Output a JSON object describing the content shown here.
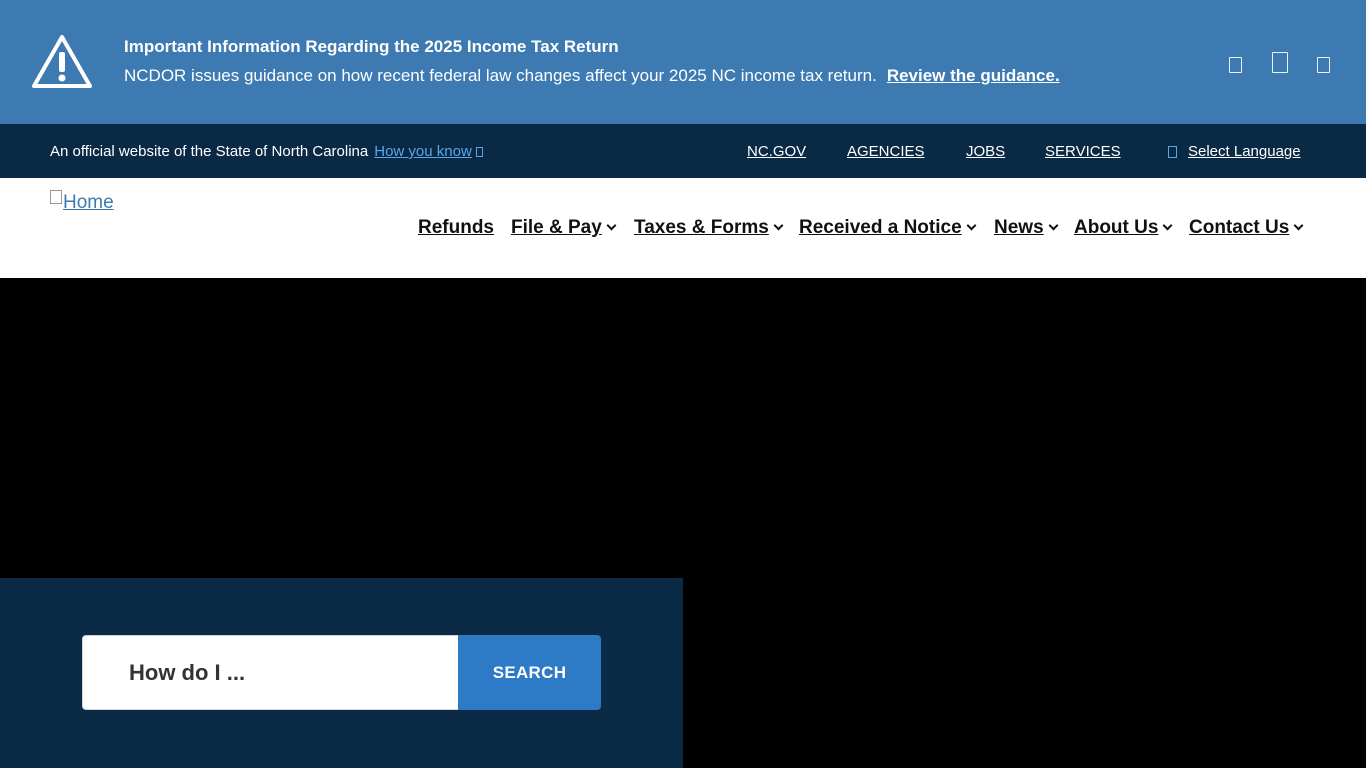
{
  "alert": {
    "title": "Important Information Regarding the 2025 Income Tax Return",
    "message": "NCDOR issues guidance on how recent federal law changes affect your 2025 NC income tax return.",
    "link_label": "Review the guidance.",
    "icon": "warning-triangle-icon"
  },
  "official_bar": {
    "text": "An official website of the State of North Carolina",
    "how_you_know": "How you know",
    "links": [
      "NC.GOV",
      "AGENCIES",
      "JOBS",
      "SERVICES"
    ],
    "language_label": "Select Language"
  },
  "header": {
    "logo_alt": "Home",
    "nav": [
      {
        "label": "Refunds",
        "has_dropdown": false
      },
      {
        "label": "File & Pay",
        "has_dropdown": true
      },
      {
        "label": "Taxes & Forms",
        "has_dropdown": true
      },
      {
        "label": "Received a Notice",
        "has_dropdown": true
      },
      {
        "label": "News",
        "has_dropdown": true
      },
      {
        "label": "About Us",
        "has_dropdown": true
      },
      {
        "label": "Contact Us",
        "has_dropdown": true
      }
    ]
  },
  "search": {
    "placeholder": "How do I ...",
    "button_label": "SEARCH"
  },
  "colors": {
    "alert_bg": "#3d7ab2",
    "official_bg": "#0a2944",
    "search_panel_bg": "#0b2a45",
    "search_button": "#2d7ac6",
    "link_blue": "#5aa6e8"
  }
}
